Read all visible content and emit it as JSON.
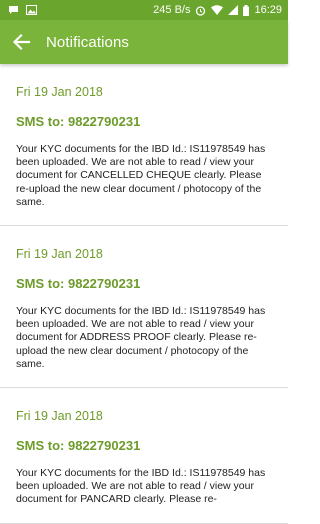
{
  "status_bar": {
    "network_speed": "245 B/s",
    "time": "16:29",
    "icons": [
      "message-icon",
      "image-icon",
      "alarm-icon",
      "wifi-icon",
      "signal-icon",
      "battery-icon"
    ]
  },
  "app_bar": {
    "title": "Notifications",
    "back_icon": "arrow-left-icon"
  },
  "notifications": [
    {
      "date": "Fri 19 Jan 2018",
      "sms_to": "SMS to: 9822790231",
      "message": "Your KYC documents for the IBD Id.: IS11978549 has been uploaded. We are not able to read / view your document for CANCELLED CHEQUE clearly. Please re-upload the new clear document / photocopy of the same."
    },
    {
      "date": "Fri 19 Jan 2018",
      "sms_to": "SMS to: 9822790231",
      "message": "Your KYC documents for the IBD Id.: IS11978549 has been uploaded. We are not able to read / view your document for ADDRESS PROOF clearly. Please re-upload the new clear document / photocopy of the same."
    },
    {
      "date": "Fri 19 Jan 2018",
      "sms_to": "SMS to: 9822790231",
      "message": "Your KYC documents for the IBD Id.: IS11978549 has been uploaded. We are not able to read / view your document for PANCARD clearly. Please re-"
    }
  ],
  "colors": {
    "status_bar": "#6aa52e",
    "app_bar": "#7bb43a",
    "accent_text": "#6e9b2a"
  }
}
